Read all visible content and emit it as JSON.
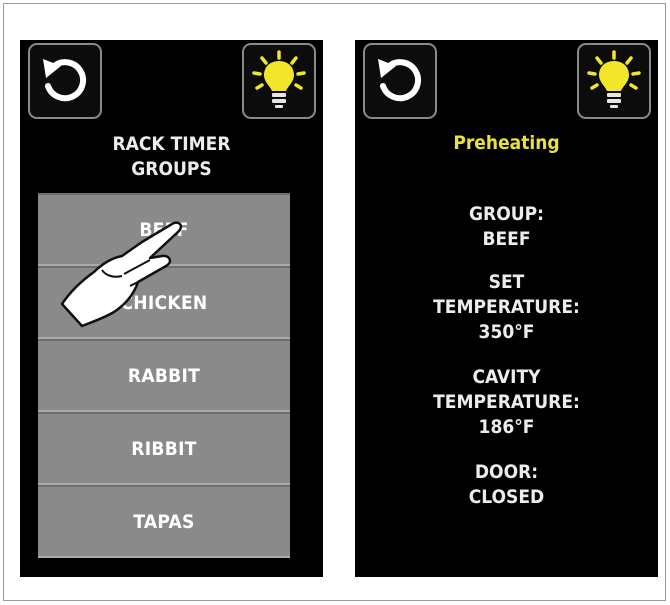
{
  "left_panel": {
    "title_line1": "RACK TIMER",
    "title_line2": "GROUPS",
    "groups": [
      "BEEF",
      "CHICKEN",
      "RABBIT",
      "RIBBIT",
      "TAPAS"
    ]
  },
  "right_panel": {
    "status": "Preheating",
    "group_label": "GROUP:",
    "group_value": "BEEF",
    "set_temp_label_line1": "SET",
    "set_temp_label_line2": "TEMPERATURE:",
    "set_temp_value": "350°F",
    "cavity_temp_label_line1": "CAVITY",
    "cavity_temp_label_line2": "TEMPERATURE:",
    "cavity_temp_value": "186°F",
    "door_label": "DOOR:",
    "door_value": "CLOSED"
  },
  "icons": {
    "back": "back-refresh-icon",
    "light": "light-bulb-icon",
    "pointer": "hand-pointer-icon"
  },
  "colors": {
    "status_yellow": "#e8e23a",
    "bulb_yellow": "#f3e52a",
    "list_gray": "#8a8a8a"
  }
}
